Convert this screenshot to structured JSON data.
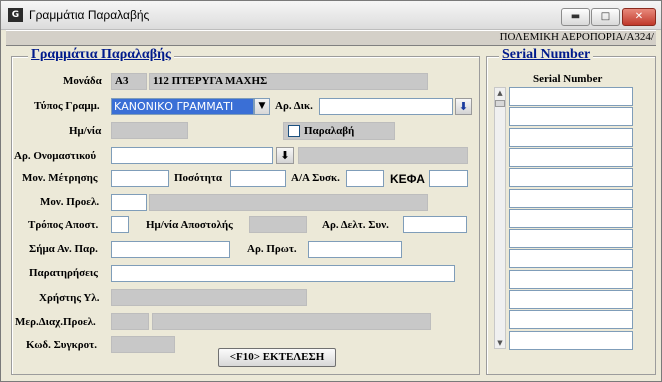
{
  "window": {
    "title": "Γραμμάτια Παραλαβής",
    "icon_text": "G",
    "controls": {
      "minimize": "▬",
      "maximize": "□",
      "close": "✕"
    }
  },
  "infobar": {
    "text": "ΠΟΛΕΜΙΚΗ ΑΕΡΟΠΟΡΙΑ/Α324/"
  },
  "main_group": {
    "legend": "Γραμμάτια Παραλαβής"
  },
  "serial_group": {
    "legend": "Serial Number",
    "header": "Serial Number",
    "rows": [
      "",
      "",
      "",
      "",
      "",
      "",
      "",
      "",
      "",
      "",
      "",
      "",
      ""
    ]
  },
  "form": {
    "monada": {
      "label": "Μονάδα",
      "code": "A3",
      "name": "112 ΠΤΕΡΥΓΑ ΜΑΧΗΣ"
    },
    "typos": {
      "label": "Τύπος Γραμμ.",
      "value": "ΚΑΝΟΝΙΚΟ ΓΡΑΜΜΑΤΙ"
    },
    "ar_dik": {
      "label": "Αρ. Δικ.",
      "value": ""
    },
    "hmnia": {
      "label": "Ημ/νία",
      "value": ""
    },
    "paralavi": {
      "label": "Παραλαβή",
      "checked": false
    },
    "ar_onom": {
      "label": "Αρ. Ονομαστικού",
      "value": "",
      "desc": ""
    },
    "mon_metr": {
      "label": "Μον. Μέτρησης",
      "value": ""
    },
    "posotita": {
      "label": "Ποσότητα",
      "value": ""
    },
    "aa_sysk": {
      "label": "Α/Α Συσκ.",
      "value": ""
    },
    "kefa": {
      "label": "ΚΕΦΑ",
      "value": ""
    },
    "mon_proel": {
      "label": "Μον. Προελ.",
      "code": "",
      "name": ""
    },
    "tropos": {
      "label": "Τρόπος Αποστ.",
      "value": ""
    },
    "hmnia_apost": {
      "label": "Ημ/νία Αποστολής",
      "value": ""
    },
    "ar_delt": {
      "label": "Αρ. Δελτ. Συν.",
      "value": ""
    },
    "sima": {
      "label": "Σήμα Αν. Παρ.",
      "value": ""
    },
    "ar_prot": {
      "label": "Αρ. Πρωτ.",
      "value": ""
    },
    "paratiriseis": {
      "label": "Παρατηρήσεις",
      "value": ""
    },
    "xristis": {
      "label": "Χρήστης Υλ.",
      "value": ""
    },
    "mer_diax": {
      "label": "Μερ.Διαχ.Προελ.",
      "code": "",
      "name": ""
    },
    "kod_sygk": {
      "label": "Κωδ. Συγκροτ.",
      "value": ""
    },
    "execute_button": "<F10> ΕΚΤΕΛΕΣΗ"
  },
  "icons": {
    "dropdown": "▼",
    "download": "⬇"
  }
}
